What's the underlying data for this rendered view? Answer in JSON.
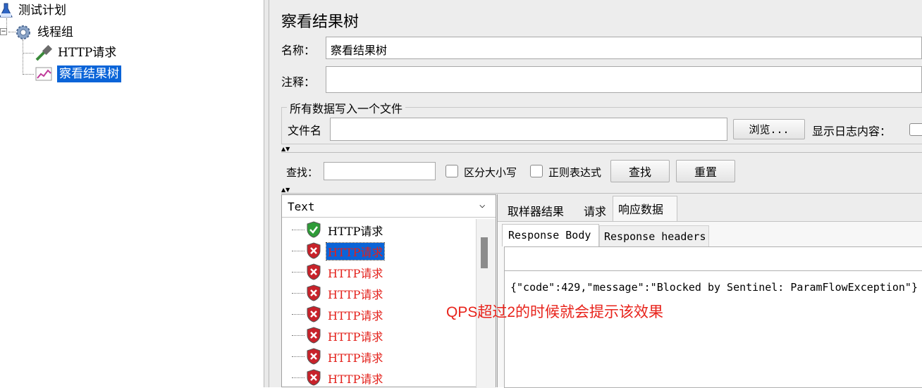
{
  "tree": {
    "items": [
      {
        "label": "测试计划",
        "icon": "test-plan-flask-icon"
      },
      {
        "label": "线程组",
        "icon": "thread-group-gear-icon"
      },
      {
        "label": "HTTP请求",
        "icon": "sampler-pipette-icon"
      },
      {
        "label": "察看结果树",
        "icon": "results-tree-chart-icon"
      }
    ]
  },
  "panel": {
    "title": "察看结果树",
    "name_label": "名称：",
    "name_value": "察看结果树",
    "comment_label": "注释：",
    "comment_value": "",
    "file_group_title": "所有数据写入一个文件",
    "filename_label": "文件名",
    "filename_value": "",
    "browse_label": "浏览...",
    "log_label": "显示日志内容："
  },
  "search": {
    "label": "查找：",
    "value": "",
    "case_label": "区分大小写",
    "regex_label": "正则表达式",
    "find_label": "查找",
    "reset_label": "重置"
  },
  "results": {
    "renderer": "Text",
    "items": [
      {
        "label": "HTTP请求",
        "status": "success"
      },
      {
        "label": "HTTP请求",
        "status": "error",
        "selected": true
      },
      {
        "label": "HTTP请求",
        "status": "error"
      },
      {
        "label": "HTTP请求",
        "status": "error"
      },
      {
        "label": "HTTP请求",
        "status": "error"
      },
      {
        "label": "HTTP请求",
        "status": "error"
      },
      {
        "label": "HTTP请求",
        "status": "error"
      },
      {
        "label": "HTTP请求",
        "status": "error"
      }
    ]
  },
  "tabs": {
    "main": [
      "取样器结果",
      "请求",
      "响应数据"
    ],
    "sub": [
      "Response Body",
      "Response headers"
    ]
  },
  "response": {
    "body": "{\"code\":429,\"message\":\"Blocked by Sentinel: ParamFlowException\"}"
  },
  "annotation": {
    "text": "QPS超过2的时候就会提示该效果",
    "color": "#e8231b"
  },
  "colors": {
    "selection": "#0a64d8",
    "error_text": "#e3201a",
    "success_shield": "#2e9b38",
    "error_shield": "#c8222a"
  }
}
